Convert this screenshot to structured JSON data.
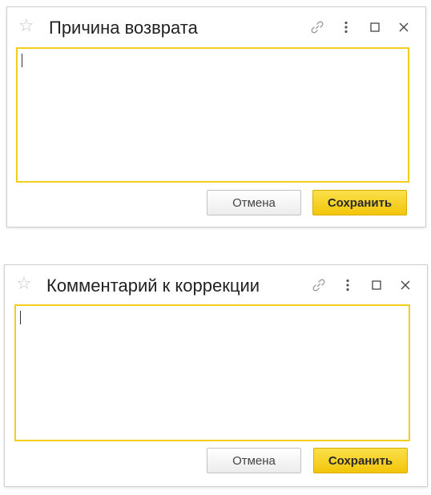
{
  "dialogs": [
    {
      "title": "Причина возврата",
      "cancel_label": "Отмена",
      "save_label": "Сохранить",
      "text_value": ""
    },
    {
      "title": "Комментарий к коррекции",
      "cancel_label": "Отмена",
      "save_label": "Сохранить",
      "text_value": ""
    }
  ],
  "icons": {
    "favorite": "star-icon",
    "link": "link-icon",
    "more": "more-icon",
    "maximize": "maximize-icon",
    "close": "close-icon"
  },
  "colors": {
    "accent_border": "#f5cd1e",
    "save_button": "#f2c50a"
  }
}
